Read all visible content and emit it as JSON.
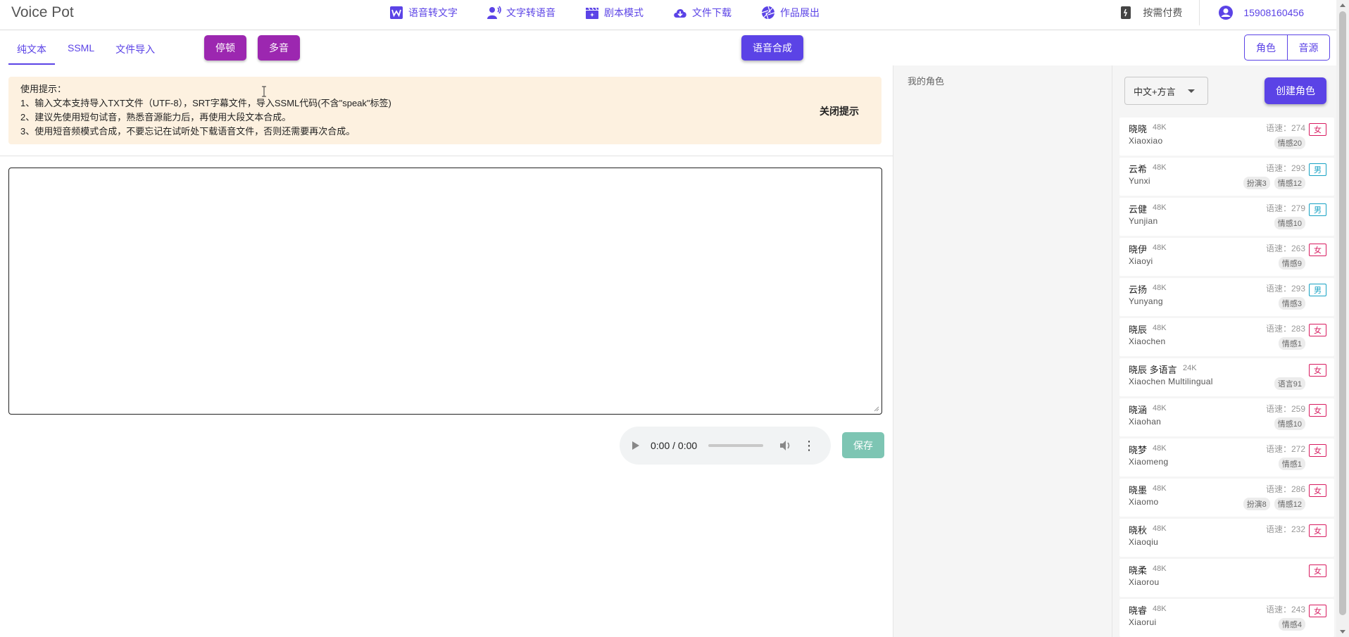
{
  "brand": "Voice Pot",
  "nav": [
    {
      "label": "语音转文字",
      "icon": "word-doc-icon"
    },
    {
      "label": "文字转语音",
      "icon": "speaker-person-icon"
    },
    {
      "label": "剧本模式",
      "icon": "clapperboard-icon"
    },
    {
      "label": "文件下载",
      "icon": "cloud-download-icon"
    },
    {
      "label": "作品展出",
      "icon": "camera-aperture-icon"
    }
  ],
  "header_right": {
    "pay_label": "按需付费",
    "user_phone": "15908160456"
  },
  "tabs": [
    "纯文本",
    "SSML",
    "文件导入"
  ],
  "toolbar": {
    "pause_label": "停顿",
    "polyphone_label": "多音",
    "synth_label": "语音合成"
  },
  "toggle": [
    "角色",
    "音源"
  ],
  "tips": {
    "title": "使用提示：",
    "lines": [
      "1、输入文本支持导入TXT文件（UTF-8），SRT字幕文件，导入SSML代码(不含\"speak\"标签)",
      "2、建议先使用短句试音，熟悉音源能力后，再使用大段文本合成。",
      "3、使用短音频模式合成，不要忘记在试听处下载语音文件，否则还需要再次合成。"
    ],
    "close_label": "关闭提示"
  },
  "player": {
    "time": "0:00 / 0:00",
    "progress": 0
  },
  "save_label": "保存",
  "my_roles_title": "我的角色",
  "language_select": "中文+方言",
  "create_role_label": "创建角色",
  "colors": {
    "accent": "#5b43e6",
    "purple": "#9c27b0",
    "save": "#7dc5b3",
    "female": "#d81b60",
    "male": "#17a2c4"
  },
  "voices": [
    {
      "name": "晓晓",
      "rate": "48K",
      "en": "Xiaoxiao",
      "speed": "语速：274",
      "tags": [
        "情感20"
      ],
      "gender": "女"
    },
    {
      "name": "云希",
      "rate": "48K",
      "en": "Yunxi",
      "speed": "语速：293",
      "tags": [
        "扮演3",
        "情感12"
      ],
      "gender": "男"
    },
    {
      "name": "云健",
      "rate": "48K",
      "en": "Yunjian",
      "speed": "语速：279",
      "tags": [
        "情感10"
      ],
      "gender": "男"
    },
    {
      "name": "晓伊",
      "rate": "48K",
      "en": "Xiaoyi",
      "speed": "语速：263",
      "tags": [
        "情感9"
      ],
      "gender": "女"
    },
    {
      "name": "云扬",
      "rate": "48K",
      "en": "Yunyang",
      "speed": "语速：293",
      "tags": [
        "情感3"
      ],
      "gender": "男"
    },
    {
      "name": "晓辰",
      "rate": "48K",
      "en": "Xiaochen",
      "speed": "语速：283",
      "tags": [
        "情感1"
      ],
      "gender": "女"
    },
    {
      "name": "晓辰 多语言",
      "rate": "24K",
      "en": "Xiaochen Multilingual",
      "speed": "",
      "tags": [
        "语言91"
      ],
      "gender": "女"
    },
    {
      "name": "晓涵",
      "rate": "48K",
      "en": "Xiaohan",
      "speed": "语速：259",
      "tags": [
        "情感10"
      ],
      "gender": "女"
    },
    {
      "name": "晓梦",
      "rate": "48K",
      "en": "Xiaomeng",
      "speed": "语速：272",
      "tags": [
        "情感1"
      ],
      "gender": "女"
    },
    {
      "name": "晓墨",
      "rate": "48K",
      "en": "Xiaomo",
      "speed": "语速：286",
      "tags": [
        "扮演8",
        "情感12"
      ],
      "gender": "女"
    },
    {
      "name": "晓秋",
      "rate": "48K",
      "en": "Xiaoqiu",
      "speed": "语速：232",
      "tags": [],
      "gender": "女"
    },
    {
      "name": "晓柔",
      "rate": "48K",
      "en": "Xiaorou",
      "speed": "",
      "tags": [],
      "gender": "女"
    },
    {
      "name": "晓睿",
      "rate": "48K",
      "en": "Xiaorui",
      "speed": "语速：243",
      "tags": [
        "情感4"
      ],
      "gender": "女"
    }
  ]
}
